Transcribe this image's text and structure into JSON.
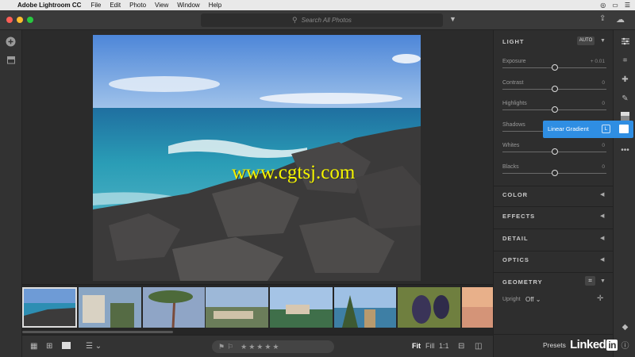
{
  "menubar": {
    "app_name": "Adobe Lightroom CC",
    "items": [
      "File",
      "Edit",
      "Photo",
      "View",
      "Window",
      "Help"
    ]
  },
  "titlebar": {
    "search_placeholder": "Search All Photos"
  },
  "edit_panel": {
    "light_title": "LIGHT",
    "auto_label": "AUTO",
    "sliders": [
      {
        "label": "Exposure",
        "value": "+ 0.01",
        "level": 0.5
      },
      {
        "label": "Contrast",
        "value": "0",
        "level": 0.5
      },
      {
        "label": "Highlights",
        "value": "0",
        "level": 0.5
      },
      {
        "label": "Shadows",
        "value": "0",
        "level": 0.5
      },
      {
        "label": "Whites",
        "value": "0",
        "level": 0.5
      },
      {
        "label": "Blacks",
        "value": "0",
        "level": 0.5
      }
    ],
    "sections": [
      "COLOR",
      "EFFECTS",
      "DETAIL",
      "OPTICS"
    ],
    "geometry_title": "GEOMETRY",
    "upright_label": "Upright",
    "upright_value": "Off"
  },
  "tooltip": {
    "label": "Linear Gradient",
    "shortcut": "L"
  },
  "bottombar": {
    "zoom": [
      "Fit",
      "Fill",
      "1:1"
    ],
    "stars": "★★★★★",
    "presets_label": "Presets"
  },
  "watermark": "www.cgtsj.com",
  "branding": {
    "linked": "Linked",
    "in": "in"
  },
  "colors": {
    "accent": "#2f8ee3",
    "window_bg": "#2b2b2b",
    "panel_bg": "#2e2e2e"
  }
}
